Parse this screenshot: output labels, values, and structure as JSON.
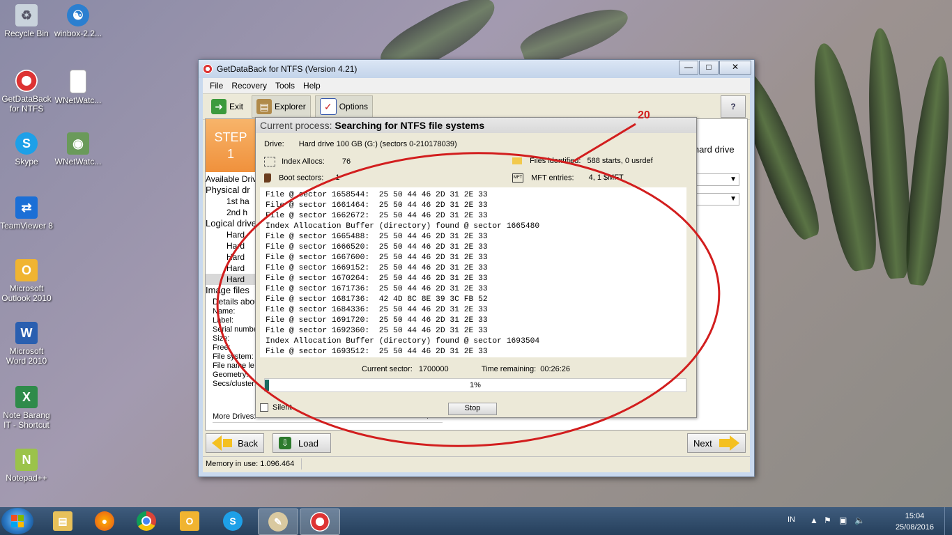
{
  "desktop": {
    "icons": [
      {
        "label": "Recycle Bin",
        "icon": "recycle-bin-icon"
      },
      {
        "label": "winbox-2.2...",
        "icon": "winbox-icon"
      },
      {
        "label": "GetDataBack for NTFS",
        "icon": "lifebuoy-icon"
      },
      {
        "label": "WNetWatc...",
        "icon": "file-icon"
      },
      {
        "label": "Skype",
        "icon": "skype-icon"
      },
      {
        "label": "WNetWatc...",
        "icon": "network-eye-icon"
      },
      {
        "label": "TeamViewer 8",
        "icon": "teamviewer-icon"
      },
      {
        "label": "Microsoft Outlook 2010",
        "icon": "outlook-icon"
      },
      {
        "label": "Microsoft Word 2010",
        "icon": "word-icon"
      },
      {
        "label": "Note Barang IT - Shortcut",
        "icon": "excel-icon"
      },
      {
        "label": "Notepad++",
        "icon": "notepadpp-icon"
      }
    ]
  },
  "window": {
    "title": "GetDataBack for NTFS (Version 4.21)",
    "menu": [
      "File",
      "Recovery",
      "Tools",
      "Help"
    ],
    "toolbar": {
      "exit": "Exit",
      "explorer": "Explorer",
      "options": "Options"
    },
    "step": {
      "line1": "STEP",
      "line2": "1"
    },
    "right_text": "d hard drive",
    "left_panel": [
      "Available Drive",
      "Physical dr",
      "1st ha",
      "2nd h",
      "Logical drive",
      "Hard",
      "Hard",
      "Hard",
      "Hard",
      "Hard",
      "Image files",
      "Details abou",
      "Name:",
      "Label:",
      "Serial numbe",
      "Size:",
      "Free:",
      "File system:",
      "File name le",
      "Geometry:",
      "Secs/cluster:"
    ],
    "more_drives": "More Drives:",
    "buttons": {
      "back": "Back",
      "load": "Load",
      "next": "Next"
    },
    "footer": "Memory in use: 1.096.464"
  },
  "dialog": {
    "header_label": "Current process:",
    "header_value": "Searching for NTFS file systems",
    "drive_label": "Drive:",
    "drive_value": "Hard drive 100 GB (G:) (sectors 0-210178039)",
    "index_allocs_label": "Index Allocs:",
    "index_allocs_value": "76",
    "boot_sectors_label": "Boot sectors:",
    "boot_sectors_value": "1",
    "files_identified_label": "Files identified:",
    "files_identified_value": "588 starts, 0 usrdef",
    "mft_entries_label": "MFT entries:",
    "mft_entries_value": "4, 1 $MFT",
    "log": [
      "File @ sector 1658544:  25 50 44 46 2D 31 2E 33",
      "File @ sector 1661464:  25 50 44 46 2D 31 2E 33",
      "File @ sector 1662672:  25 50 44 46 2D 31 2E 33",
      "Index Allocation Buffer (directory) found @ sector 1665480",
      "File @ sector 1665488:  25 50 44 46 2D 31 2E 33",
      "File @ sector 1666520:  25 50 44 46 2D 31 2E 33",
      "File @ sector 1667600:  25 50 44 46 2D 31 2E 33",
      "File @ sector 1669152:  25 50 44 46 2D 31 2E 33",
      "File @ sector 1670264:  25 50 44 46 2D 31 2E 33",
      "File @ sector 1671736:  25 50 44 46 2D 31 2E 33",
      "File @ sector 1681736:  42 4D 8C 8E 39 3C FB 52",
      "File @ sector 1684336:  25 50 44 46 2D 31 2E 33",
      "File @ sector 1691720:  25 50 44 46 2D 31 2E 33",
      "File @ sector 1692360:  25 50 44 46 2D 31 2E 33",
      "Index Allocation Buffer (directory) found @ sector 1693504",
      "File @ sector 1693512:  25 50 44 46 2D 31 2E 33"
    ],
    "current_sector_label": "Current sector:",
    "current_sector_value": "1700000",
    "time_remaining_label": "Time remaining:",
    "time_remaining_value": "00:26:26",
    "progress_fraction": 0.01,
    "progress_text": "1%",
    "silent_label": "Silent",
    "stop_label": "Stop"
  },
  "annotation": {
    "number": "20",
    "color": "#d21e1e"
  },
  "taskbar": {
    "items": [
      "explorer-icon",
      "firefox-icon",
      "chrome-icon",
      "outlook-icon",
      "skype-icon",
      "paint-icon",
      "lifebuoy-icon"
    ],
    "language": "IN",
    "time": "15:04",
    "date": "25/08/2016"
  }
}
